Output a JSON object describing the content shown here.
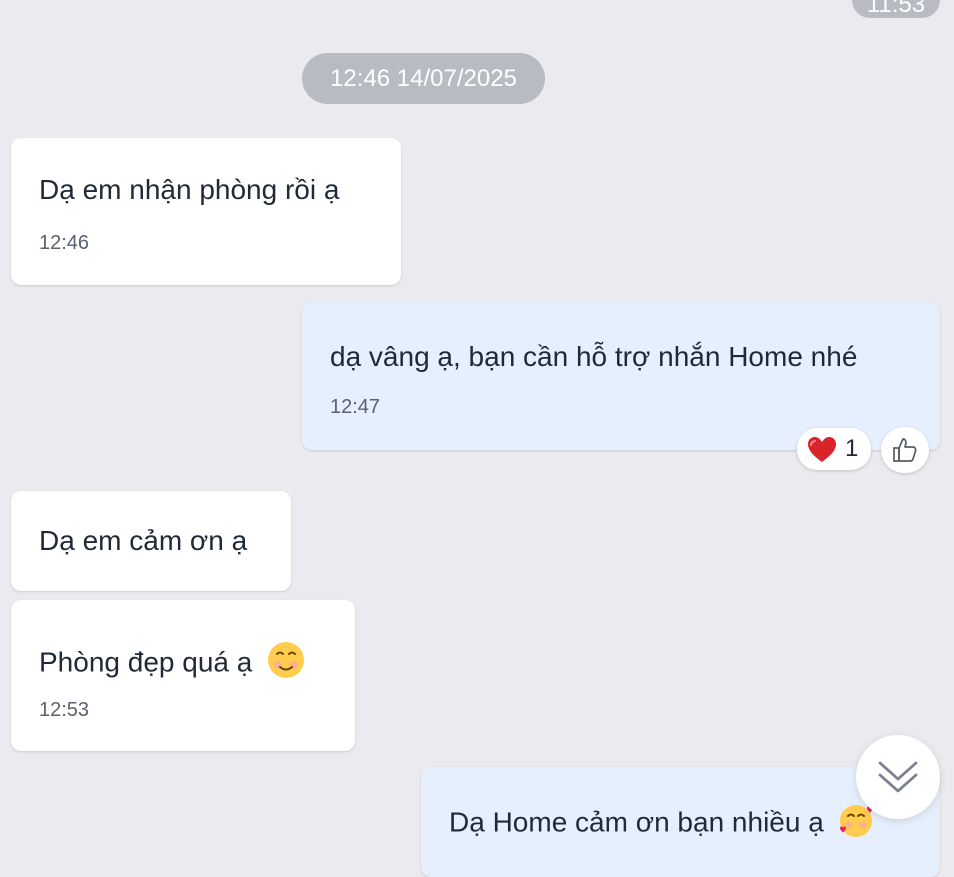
{
  "chat": {
    "top_partial_time": "11:53",
    "date_separator": "12:46 14/07/2025",
    "messages": [
      {
        "sender": "guest",
        "text": "Dạ em nhận phòng rồi ạ",
        "time": "12:46"
      },
      {
        "sender": "host",
        "text": "dạ vâng ạ, bạn cần hỗ trợ nhắn Home nhé",
        "time": "12:47",
        "reactions": {
          "heart_count": "1",
          "icons": [
            "heart-icon",
            "thumbs-up-icon"
          ]
        }
      },
      {
        "sender": "guest",
        "text": "Dạ em cảm ơn ạ"
      },
      {
        "sender": "guest",
        "text": "Phòng đẹp quá ạ",
        "emoji": "smiling-face-icon",
        "time": "12:53"
      },
      {
        "sender": "host",
        "text": "Dạ Home cảm ơn bạn nhiều ạ",
        "emoji": "blushing-face-with-hearts-icon"
      }
    ],
    "scroll_button_icon": "double-chevron-down-icon"
  },
  "colors": {
    "background": "#ebebef",
    "guest_bubble": "#ffffff",
    "host_bubble": "#e6effd",
    "pill": "#b8bbc1",
    "time_text": "#5b6170"
  }
}
